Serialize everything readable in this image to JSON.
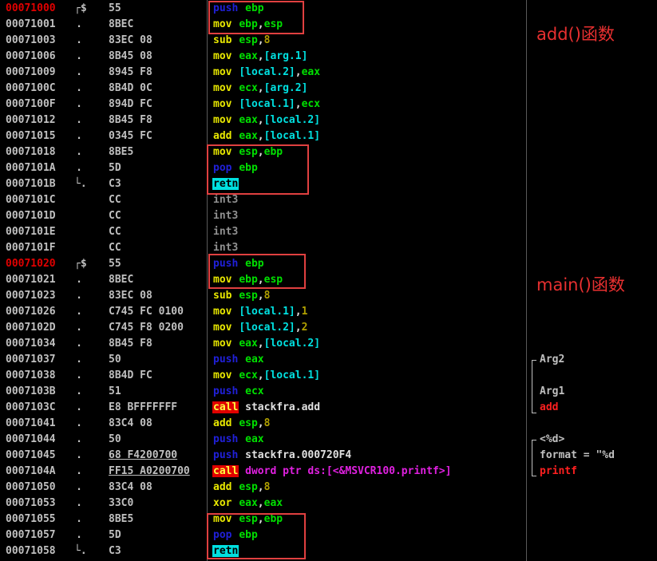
{
  "annotations": {
    "add_label": "add()函数",
    "main_label": "main()函数"
  },
  "colors": {
    "background": "#000000",
    "address": "#c0c0c0",
    "label_address": "#e00000",
    "highlight_box": "#e04040"
  },
  "rows": [
    {
      "addr": "00071000",
      "label": true,
      "mark": "┌$",
      "hex": "55",
      "op": "push",
      "kind": "push",
      "args": [
        [
          "reg",
          "ebp"
        ]
      ],
      "comment": []
    },
    {
      "addr": "00071001",
      "mark": ".",
      "hex": "8BEC",
      "op": "mov",
      "kind": "mov",
      "args": [
        [
          "reg",
          "ebp"
        ],
        [
          "txt",
          ","
        ],
        [
          "reg",
          "esp"
        ]
      ],
      "comment": []
    },
    {
      "addr": "00071003",
      "mark": ".",
      "hex": "83EC 08",
      "op": "sub",
      "kind": "sub",
      "args": [
        [
          "reg",
          "esp"
        ],
        [
          "txt",
          ","
        ],
        [
          "num",
          "8"
        ]
      ],
      "comment": []
    },
    {
      "addr": "00071006",
      "mark": ".",
      "hex": "8B45 08",
      "op": "mov",
      "kind": "mov",
      "args": [
        [
          "reg",
          "eax"
        ],
        [
          "txt",
          ","
        ],
        [
          "ref",
          "[arg.1]"
        ]
      ],
      "comment": []
    },
    {
      "addr": "00071009",
      "mark": ".",
      "hex": "8945 F8",
      "op": "mov",
      "kind": "mov",
      "args": [
        [
          "ref",
          "[local.2]"
        ],
        [
          "txt",
          ","
        ],
        [
          "reg",
          "eax"
        ]
      ],
      "comment": []
    },
    {
      "addr": "0007100C",
      "mark": ".",
      "hex": "8B4D 0C",
      "op": "mov",
      "kind": "mov",
      "args": [
        [
          "reg",
          "ecx"
        ],
        [
          "txt",
          ","
        ],
        [
          "ref",
          "[arg.2]"
        ]
      ],
      "comment": []
    },
    {
      "addr": "0007100F",
      "mark": ".",
      "hex": "894D FC",
      "op": "mov",
      "kind": "mov",
      "args": [
        [
          "ref",
          "[local.1]"
        ],
        [
          "txt",
          ","
        ],
        [
          "reg",
          "ecx"
        ]
      ],
      "comment": []
    },
    {
      "addr": "00071012",
      "mark": ".",
      "hex": "8B45 F8",
      "op": "mov",
      "kind": "mov",
      "args": [
        [
          "reg",
          "eax"
        ],
        [
          "txt",
          ","
        ],
        [
          "ref",
          "[local.2]"
        ]
      ],
      "comment": []
    },
    {
      "addr": "00071015",
      "mark": ".",
      "hex": "0345 FC",
      "op": "add",
      "kind": "add",
      "args": [
        [
          "reg",
          "eax"
        ],
        [
          "txt",
          ","
        ],
        [
          "ref",
          "[local.1]"
        ]
      ],
      "comment": []
    },
    {
      "addr": "00071018",
      "mark": ".",
      "hex": "8BE5",
      "op": "mov",
      "kind": "mov",
      "args": [
        [
          "reg",
          "esp"
        ],
        [
          "txt",
          ","
        ],
        [
          "reg",
          "ebp"
        ]
      ],
      "comment": []
    },
    {
      "addr": "0007101A",
      "mark": ".",
      "hex": "5D",
      "op": "pop",
      "kind": "pop",
      "args": [
        [
          "reg",
          "ebp"
        ]
      ],
      "comment": []
    },
    {
      "addr": "0007101B",
      "mark": "└.",
      "hex": "C3",
      "op": "retn",
      "kind": "retn",
      "args": [],
      "comment": []
    },
    {
      "addr": "0007101C",
      "mark": "",
      "hex": "CC",
      "op": "int3",
      "kind": "int3",
      "args": [],
      "comment": []
    },
    {
      "addr": "0007101D",
      "mark": "",
      "hex": "CC",
      "op": "int3",
      "kind": "int3",
      "args": [],
      "comment": []
    },
    {
      "addr": "0007101E",
      "mark": "",
      "hex": "CC",
      "op": "int3",
      "kind": "int3",
      "args": [],
      "comment": []
    },
    {
      "addr": "0007101F",
      "mark": "",
      "hex": "CC",
      "op": "int3",
      "kind": "int3",
      "args": [],
      "comment": []
    },
    {
      "addr": "00071020",
      "label": true,
      "mark": "┌$",
      "hex": "55",
      "op": "push",
      "kind": "push",
      "args": [
        [
          "reg",
          "ebp"
        ]
      ],
      "comment": []
    },
    {
      "addr": "00071021",
      "mark": ".",
      "hex": "8BEC",
      "op": "mov",
      "kind": "mov",
      "args": [
        [
          "reg",
          "ebp"
        ],
        [
          "txt",
          ","
        ],
        [
          "reg",
          "esp"
        ]
      ],
      "comment": []
    },
    {
      "addr": "00071023",
      "mark": ".",
      "hex": "83EC 08",
      "op": "sub",
      "kind": "sub",
      "args": [
        [
          "reg",
          "esp"
        ],
        [
          "txt",
          ","
        ],
        [
          "num",
          "8"
        ]
      ],
      "comment": []
    },
    {
      "addr": "00071026",
      "mark": ".",
      "hex": "C745 FC 0100",
      "op": "mov",
      "kind": "mov",
      "args": [
        [
          "ref",
          "[local.1]"
        ],
        [
          "txt",
          ","
        ],
        [
          "num",
          "1"
        ]
      ],
      "comment": []
    },
    {
      "addr": "0007102D",
      "mark": ".",
      "hex": "C745 F8 0200",
      "op": "mov",
      "kind": "mov",
      "args": [
        [
          "ref",
          "[local.2]"
        ],
        [
          "txt",
          ","
        ],
        [
          "num",
          "2"
        ]
      ],
      "comment": []
    },
    {
      "addr": "00071034",
      "mark": ".",
      "hex": "8B45 F8",
      "op": "mov",
      "kind": "mov",
      "args": [
        [
          "reg",
          "eax"
        ],
        [
          "txt",
          ","
        ],
        [
          "ref",
          "[local.2]"
        ]
      ],
      "comment": []
    },
    {
      "addr": "00071037",
      "mark": ".",
      "hex": "50",
      "op": "push",
      "kind": "push",
      "args": [
        [
          "reg",
          "eax"
        ]
      ],
      "comment": [
        [
          "plain",
          "Arg2"
        ]
      ]
    },
    {
      "addr": "00071038",
      "mark": ".",
      "hex": "8B4D FC",
      "op": "mov",
      "kind": "mov",
      "args": [
        [
          "reg",
          "ecx"
        ],
        [
          "txt",
          ","
        ],
        [
          "ref",
          "[local.1]"
        ]
      ],
      "comment": []
    },
    {
      "addr": "0007103B",
      "mark": ".",
      "hex": "51",
      "op": "push",
      "kind": "push",
      "args": [
        [
          "reg",
          "ecx"
        ]
      ],
      "comment": [
        [
          "plain",
          "Arg1"
        ]
      ]
    },
    {
      "addr": "0007103C",
      "mark": ".",
      "hex": "E8 BFFFFFFF",
      "op": "call",
      "kind": "call",
      "args": [
        [
          "txt",
          "stackfra.add"
        ]
      ],
      "comment": [
        [
          "red",
          "add"
        ]
      ]
    },
    {
      "addr": "00071041",
      "mark": ".",
      "hex": "83C4 08",
      "op": "add",
      "kind": "add",
      "args": [
        [
          "reg",
          "esp"
        ],
        [
          "txt",
          ","
        ],
        [
          "num",
          "8"
        ]
      ],
      "comment": []
    },
    {
      "addr": "00071044",
      "mark": ".",
      "hex": "50",
      "op": "push",
      "kind": "push",
      "args": [
        [
          "reg",
          "eax"
        ]
      ],
      "comment": [
        [
          "plain",
          "<%d>"
        ]
      ]
    },
    {
      "addr": "00071045",
      "mark": ".",
      "hex": "68 F4200700",
      "hexul": true,
      "op": "push",
      "kind": "push",
      "args": [
        [
          "txt",
          "stackfra.000720F4"
        ]
      ],
      "comment": [
        [
          "plain",
          "format = \"%d"
        ]
      ]
    },
    {
      "addr": "0007104A",
      "mark": ".",
      "hex": "FF15 A0200700",
      "hexul": true,
      "op": "call",
      "kind": "call",
      "args": [
        [
          "ptr",
          "dword ptr ds:[<&MSVCR100.printf>]"
        ]
      ],
      "comment": [
        [
          "red",
          "printf"
        ]
      ]
    },
    {
      "addr": "00071050",
      "mark": ".",
      "hex": "83C4 08",
      "op": "add",
      "kind": "add",
      "args": [
        [
          "reg",
          "esp"
        ],
        [
          "txt",
          ","
        ],
        [
          "num",
          "8"
        ]
      ],
      "comment": []
    },
    {
      "addr": "00071053",
      "mark": ".",
      "hex": "33C0",
      "op": "xor",
      "kind": "xor",
      "args": [
        [
          "reg",
          "eax"
        ],
        [
          "txt",
          ","
        ],
        [
          "reg",
          "eax"
        ]
      ],
      "comment": []
    },
    {
      "addr": "00071055",
      "mark": ".",
      "hex": "8BE5",
      "op": "mov",
      "kind": "mov",
      "args": [
        [
          "reg",
          "esp"
        ],
        [
          "txt",
          ","
        ],
        [
          "reg",
          "ebp"
        ]
      ],
      "comment": []
    },
    {
      "addr": "00071057",
      "mark": ".",
      "hex": "5D",
      "op": "pop",
      "kind": "pop",
      "args": [
        [
          "reg",
          "ebp"
        ]
      ],
      "comment": []
    },
    {
      "addr": "00071058",
      "mark": "└.",
      "hex": "C3",
      "op": "retn",
      "kind": "retn",
      "args": [],
      "comment": []
    }
  ]
}
